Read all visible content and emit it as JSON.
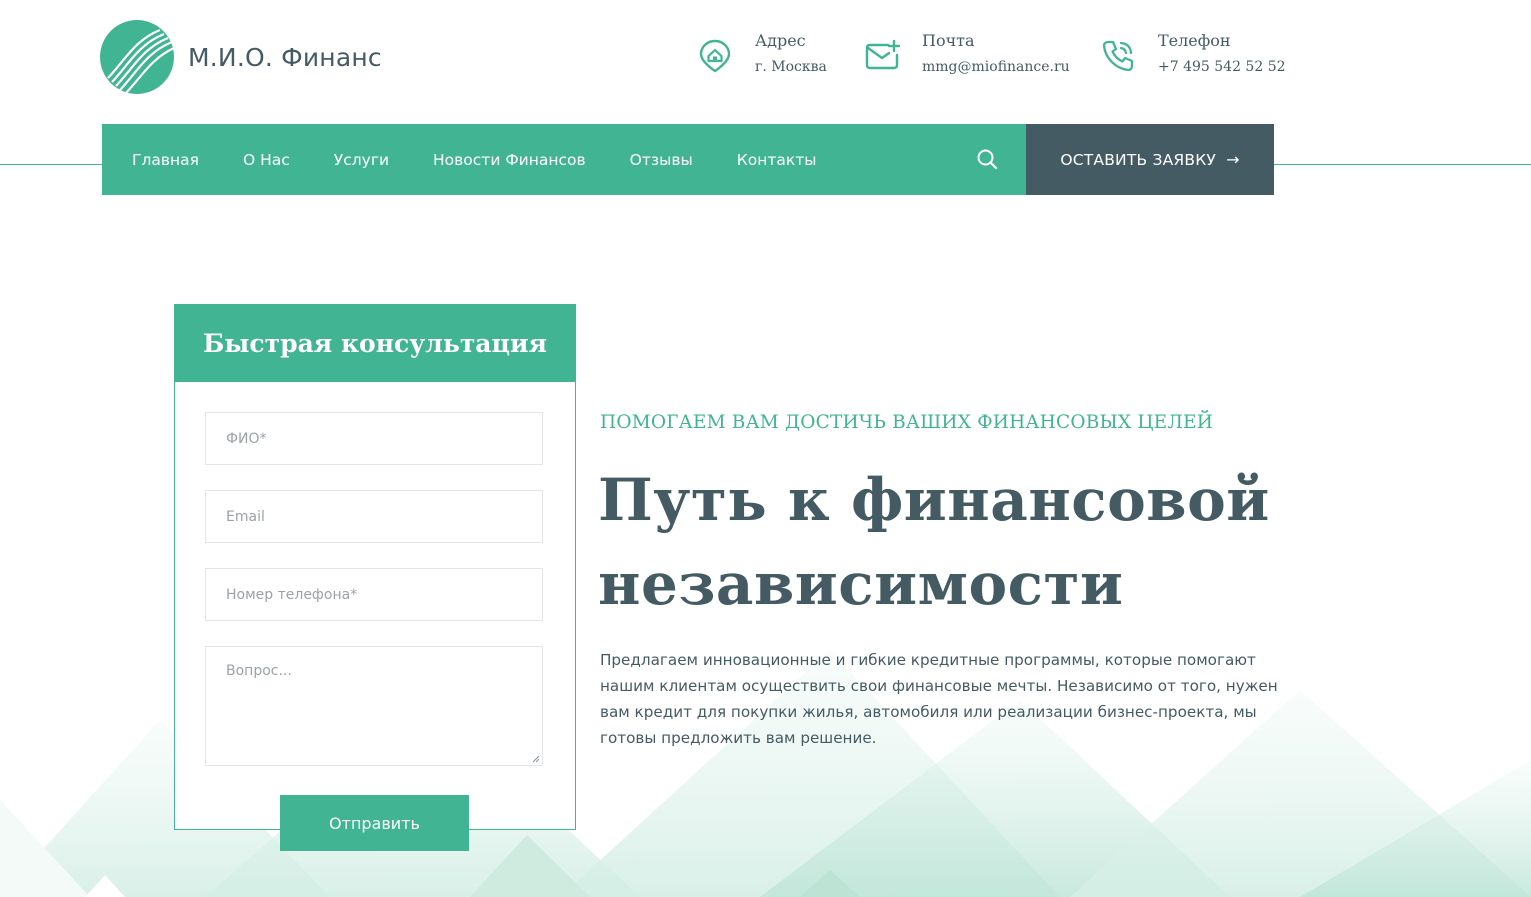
{
  "brand": {
    "name": "М.И.О. Финанс",
    "color_primary": "#41b494",
    "color_dark": "#455b63"
  },
  "contacts": {
    "address": {
      "label": "Адрес",
      "value": "г. Москва",
      "icon": "location-home-pin-icon"
    },
    "email": {
      "label": "Почта",
      "value": "mmg@miofinance.ru",
      "icon": "mail-plus-icon"
    },
    "phone": {
      "label": "Телефон",
      "value": "+7 495 542 52 52",
      "icon": "phone-call-icon"
    }
  },
  "nav": {
    "items": [
      "Главная",
      "О Нас",
      "Услуги",
      "Новости Финансов",
      "Отзывы",
      "Контакты"
    ],
    "search_icon": "search-icon",
    "cta_label": "ОСТАВИТЬ ЗАЯВКУ",
    "cta_arrow": "→"
  },
  "form": {
    "title": "Быстрая консультация",
    "name_placeholder": "ФИО*",
    "email_placeholder": "Email",
    "phone_placeholder": "Номер телефона*",
    "question_placeholder": "Вопрос...",
    "submit_label": "Отправить"
  },
  "hero": {
    "tagline": "ПОМОГАЕМ ВАМ ДОСТИЧЬ ВАШИХ ФИНАНСОВЫХ ЦЕЛЕЙ",
    "title_line1": "Путь к финансовой",
    "title_line2": "независимости",
    "text": "Предлагаем инновационные и гибкие кредитные программы, которые помогают нашим клиентам осуществить свои финансовые мечты. Независимо от того, нужен вам кредит для покупки жилья, автомобиля или реализации бизнес-проекта, мы готовы предложить вам решение."
  }
}
